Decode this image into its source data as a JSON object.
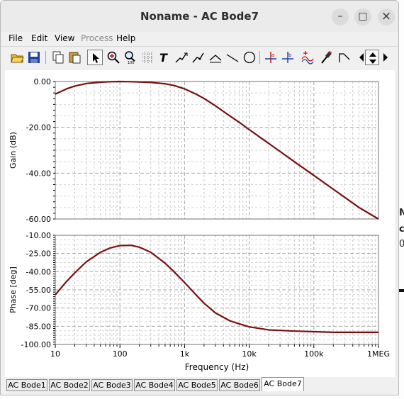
{
  "window": {
    "title": "Noname - AC Bode7",
    "controls": {
      "minimize": "–",
      "maximize": "□",
      "close": "×"
    }
  },
  "menu": {
    "items": [
      {
        "label": "File",
        "enabled": true
      },
      {
        "label": "Edit",
        "enabled": true
      },
      {
        "label": "View",
        "enabled": true
      },
      {
        "label": "Process",
        "enabled": false
      },
      {
        "label": "Help",
        "enabled": true
      }
    ]
  },
  "toolbar": {
    "icons": [
      "open-icon",
      "save-icon",
      "copy-icon",
      "paste-icon",
      "pointer-icon",
      "zoom-in-icon",
      "zoom-100-icon",
      "grid-icon",
      "text-icon",
      "line-cursor-icon",
      "line-cursor-alt-icon",
      "ruler-icon",
      "line-icon",
      "ellipse-icon",
      "cursor-a-icon",
      "cursor-b-icon",
      "trace-add-icon",
      "pipette-icon",
      "corner-icon",
      "arrow-left-icon",
      "arrow-up-down-icon",
      "arrow-right-icon"
    ]
  },
  "background_fragments": [
    "N",
    "c",
    "0"
  ],
  "chart_data": [
    {
      "type": "line",
      "ylabel": "Gain (dB)",
      "xscale": "log",
      "xlim": [
        10,
        1000000
      ],
      "ylim": [
        -60,
        0
      ],
      "yticks": [
        "0.00",
        "-20.00",
        "-40.00",
        "-60.00"
      ],
      "grid": true,
      "line_color": "#7a1010",
      "series": [
        {
          "x": [
            10,
            15,
            20,
            30,
            50,
            70,
            100,
            150,
            200,
            300,
            500,
            700,
            1000,
            1500,
            2000,
            3000,
            5000,
            7000,
            10000,
            20000,
            50000,
            100000,
            200000,
            500000,
            1000000
          ],
          "y": [
            -5.5,
            -3.2,
            -2.0,
            -0.9,
            -0.3,
            -0.1,
            0,
            -0.1,
            -0.2,
            -0.4,
            -1.0,
            -1.8,
            -3.2,
            -5.5,
            -7.4,
            -10.6,
            -15.0,
            -17.8,
            -21.0,
            -27.0,
            -35.0,
            -41.0,
            -47.0,
            -55.0,
            -60.0
          ]
        }
      ]
    },
    {
      "type": "line",
      "xlabel": "Frequency (Hz)",
      "ylabel": "Phase [deg]",
      "xscale": "log",
      "xlim": [
        10,
        1000000
      ],
      "ylim": [
        -100,
        -10
      ],
      "yticks": [
        "-10.00",
        "-25.00",
        "-40.00",
        "-55.00",
        "-70.00",
        "-85.00",
        "-100.00"
      ],
      "xticks": [
        "10",
        "100",
        "1k",
        "10k",
        "100k",
        "1MEG"
      ],
      "xtick_values": [
        10,
        100,
        1000,
        10000,
        100000,
        1000000
      ],
      "grid": true,
      "line_color": "#7a1010",
      "series": [
        {
          "x": [
            10,
            15,
            20,
            30,
            50,
            70,
            100,
            150,
            200,
            300,
            500,
            700,
            1000,
            1500,
            2000,
            3000,
            5000,
            7000,
            10000,
            20000,
            50000,
            100000,
            200000,
            500000,
            1000000
          ],
          "y": [
            -59,
            -48,
            -41,
            -32,
            -24,
            -20.5,
            -18.5,
            -18.3,
            -19.8,
            -24,
            -33,
            -40.5,
            -49,
            -59,
            -66,
            -74,
            -80.5,
            -83,
            -85.5,
            -88,
            -89,
            -89.5,
            -90,
            -90,
            -90
          ]
        }
      ]
    }
  ],
  "tabs": {
    "items": [
      "AC Bode1",
      "AC Bode2",
      "AC Bode3",
      "AC Bode4",
      "AC Bode5",
      "AC Bode6",
      "AC Bode7"
    ],
    "active": "AC Bode7"
  }
}
